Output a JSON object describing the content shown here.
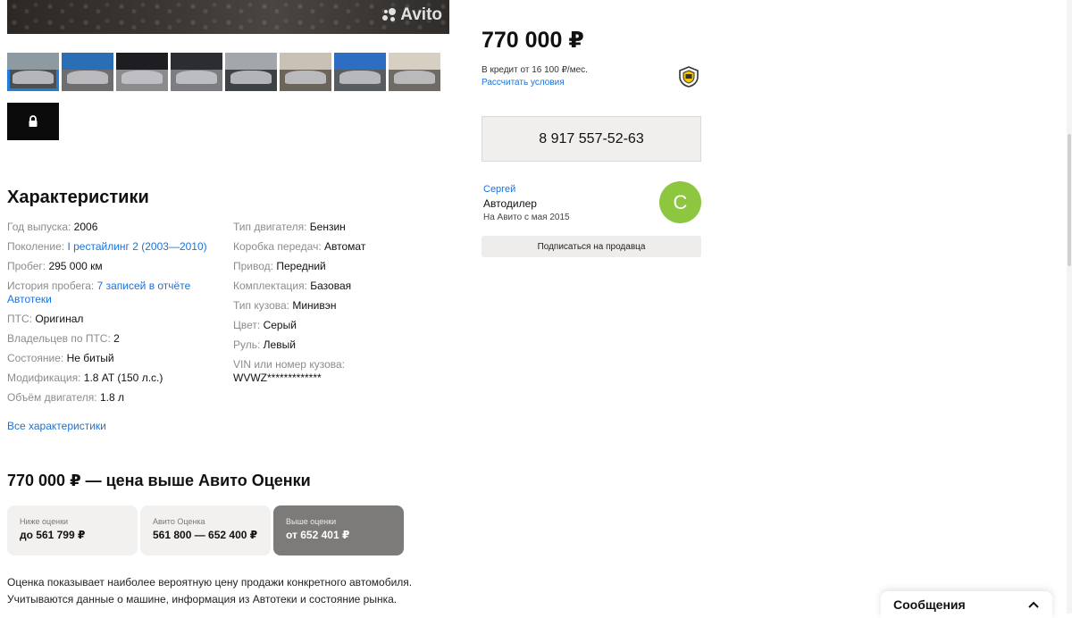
{
  "gallery": {
    "watermark": "Avito",
    "thumbnails": [
      {
        "alt": "photo-1",
        "sky": "#8e9aa2",
        "ground": "#4a4f52"
      },
      {
        "alt": "photo-2",
        "sky": "#2a6fb5",
        "ground": "#6d6e6f"
      },
      {
        "alt": "photo-3",
        "sky": "#1e1e22",
        "ground": "#8a8b8d"
      },
      {
        "alt": "photo-4",
        "sky": "#2b2d30",
        "ground": "#7b7d80"
      },
      {
        "alt": "photo-5",
        "sky": "#a3a7ab",
        "ground": "#3f4244"
      },
      {
        "alt": "photo-6",
        "sky": "#c9c2b4",
        "ground": "#6b6458"
      },
      {
        "alt": "photo-7",
        "sky": "#2d6ec2",
        "ground": "#5a5d60"
      },
      {
        "alt": "photo-8",
        "sky": "#d8cfc3",
        "ground": "#6e6a64"
      }
    ]
  },
  "specs": {
    "title": "Характеристики",
    "left": [
      {
        "label": "Год выпуска:",
        "value": "2006"
      },
      {
        "label": "Поколение:",
        "link": "I рестайлинг 2 (2003—2010)"
      },
      {
        "label": "Пробег:",
        "value": "295 000 км"
      },
      {
        "label": "История пробега:",
        "link": "7 записей в отчёте Автотеки"
      },
      {
        "label": "ПТС:",
        "value": "Оригинал"
      },
      {
        "label": "Владельцев по ПТС:",
        "value": "2"
      },
      {
        "label": "Состояние:",
        "value": "Не битый"
      },
      {
        "label": "Модификация:",
        "value": "1.8 AT (150 л.с.)"
      },
      {
        "label": "Объём двигателя:",
        "value": "1.8 л"
      }
    ],
    "right": [
      {
        "label": "Тип двигателя:",
        "value": "Бензин"
      },
      {
        "label": "Коробка передач:",
        "value": "Автомат"
      },
      {
        "label": "Привод:",
        "value": "Передний"
      },
      {
        "label": "Комплектация:",
        "value": "Базовая"
      },
      {
        "label": "Тип кузова:",
        "value": "Минивэн"
      },
      {
        "label": "Цвет:",
        "value": "Серый"
      },
      {
        "label": "Руль:",
        "value": "Левый"
      },
      {
        "label": "VIN или номер кузова:",
        "value": "WVWZ*************"
      }
    ],
    "all_link": "Все характеристики"
  },
  "evaluation": {
    "title": "770 000 ₽ — цена выше Авито Оценки",
    "boxes": [
      {
        "caption": "Ниже оценки",
        "value": "до 561 799 ₽",
        "active": false
      },
      {
        "caption": "Авито Оценка",
        "value": "561 800 — 652 400 ₽",
        "active": false
      },
      {
        "caption": "Выше оценки",
        "value": "от 652 401 ₽",
        "active": true
      }
    ],
    "note_line1": "Оценка показывает наиболее вероятную цену продажи конкретного автомобиля.",
    "note_line2": "Учитываются данные о машине, информация из Автотеки и состояние рынка."
  },
  "sidebar": {
    "price": "770 000 ₽",
    "credit_text": "В кредит от 16 100 ₽/мес.",
    "credit_link": "Рассчитать условия",
    "phone": "8 917 557-52-63",
    "seller_name": "Сергей",
    "seller_type": "Автодилер",
    "seller_since": "На Авито с мая 2015",
    "avatar_letter": "С",
    "avatar_color": "#8dc63f",
    "subscribe": "Подписаться на продавца"
  },
  "messages": {
    "label": "Сообщения"
  }
}
